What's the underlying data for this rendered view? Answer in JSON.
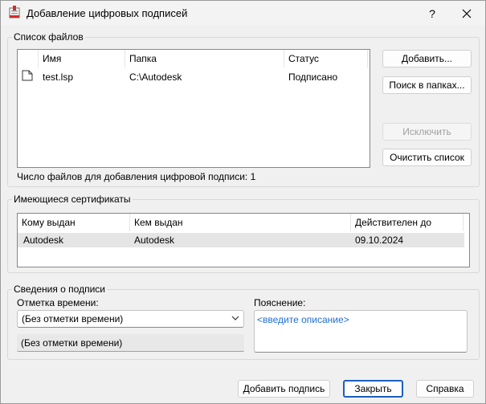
{
  "window": {
    "title": "Добавление цифровых подписей",
    "help_label": "?",
    "close_label": "✕"
  },
  "files": {
    "group_label": "Список файлов",
    "columns": [
      "",
      "Имя",
      "Папка",
      "Статус"
    ],
    "rows": [
      {
        "icon": "document-icon",
        "name": "test.lsp",
        "folder": "C:\\Autodesk",
        "status": "Подписано"
      }
    ],
    "count_text": "Число файлов для добавления цифровой подписи: 1",
    "buttons": {
      "add": "Добавить...",
      "search": "Поиск в папках...",
      "exclude": "Исключить",
      "clear": "Очистить список"
    }
  },
  "certs": {
    "group_label": "Имеющиеся сертификаты",
    "columns": [
      "Кому выдан",
      "Кем выдан",
      "Действителен до"
    ],
    "rows": [
      {
        "issued_to": "Autodesk",
        "issued_by": "Autodesk",
        "valid_until": "09.10.2024"
      }
    ]
  },
  "signature": {
    "group_label": "Сведения о подписи",
    "timestamp_label": "Отметка времени:",
    "timestamp_selected": "(Без отметки времени)",
    "timestamp_info": "(Без отметки времени)",
    "description_label": "Пояснение:",
    "description_placeholder": "<введите описание>"
  },
  "footer": {
    "add_signature": "Добавить подпись",
    "close": "Закрыть",
    "help": "Справка"
  },
  "colors": {
    "accent": "#1b5fbf",
    "placeholder_text": "#1f6fd1",
    "selected_row": "#e5e5e5"
  }
}
